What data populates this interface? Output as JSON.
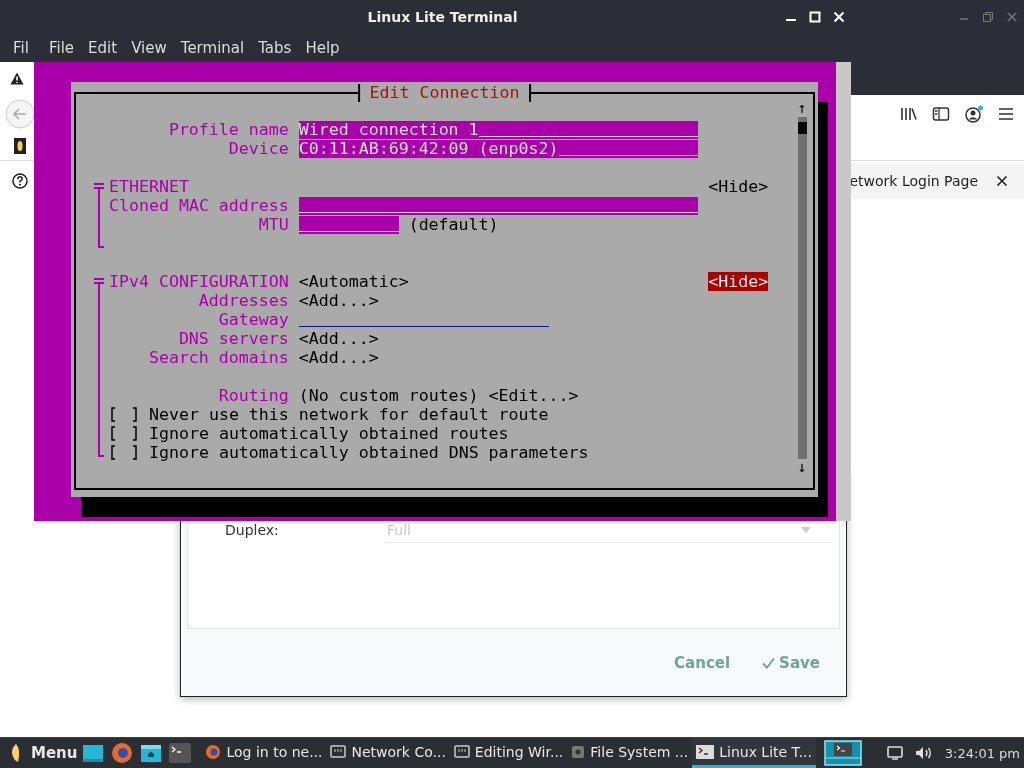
{
  "browser": {
    "menu_partial": "Fil",
    "notice_tab": "etwork Login Page"
  },
  "network_dialog": {
    "rows": [
      {
        "label": "Duplex:",
        "value": "Full",
        "disabled": true
      }
    ],
    "buttons": [
      {
        "label": "Cancel",
        "kind": "plain"
      },
      {
        "label": "Save",
        "kind": "confirm"
      }
    ]
  },
  "terminal": {
    "title": "Linux Lite Terminal",
    "menu": [
      "File",
      "Edit",
      "View",
      "Terminal",
      "Tabs",
      "Help"
    ],
    "dialog": {
      "title": "Edit Connection",
      "scroll_up": "↑",
      "scroll_down": "↓",
      "top_fields": [
        {
          "label": "Profile name",
          "value": "Wired connection 1"
        },
        {
          "label": "Device",
          "value": "C0:11:AB:69:42:09 (enp0s2)"
        }
      ],
      "sections": [
        {
          "heading": "ETHERNET",
          "toggle": "<Hide>",
          "toggle_focused": false,
          "rows": [
            {
              "kind": "field",
              "label": "Cloned MAC address"
            },
            {
              "kind": "short_field",
              "label": "MTU",
              "suffix": "(default)"
            },
            {
              "kind": "spacer"
            }
          ]
        },
        {
          "heading": "IPv4 CONFIGURATION",
          "mode": "<Automatic>",
          "toggle": "<Hide>",
          "toggle_focused": true,
          "rows": [
            {
              "kind": "button",
              "label": "Addresses",
              "value": "<Add...>"
            },
            {
              "kind": "underline_field",
              "label": "Gateway"
            },
            {
              "kind": "button",
              "label": "DNS servers",
              "value": "<Add...>"
            },
            {
              "kind": "button",
              "label": "Search domains",
              "value": "<Add...>"
            },
            {
              "kind": "spacer"
            },
            {
              "kind": "text_button",
              "label": "Routing",
              "value": "(No custom routes)",
              "button": "<Edit...>"
            },
            {
              "kind": "checkbox",
              "checked": false,
              "label": "Never use this network for default route"
            },
            {
              "kind": "checkbox",
              "checked": false,
              "label": "Ignore automatically obtained routes"
            },
            {
              "kind": "checkbox",
              "checked": false,
              "label": "Ignore automatically obtained DNS parameters"
            }
          ]
        }
      ]
    }
  },
  "taskbar": {
    "menu": "Menu",
    "tasks": [
      {
        "label": "Log in to ne...",
        "kind": "browser",
        "selected": false
      },
      {
        "label": "Network Co...",
        "kind": "network",
        "selected": false
      },
      {
        "label": "Editing Wir...",
        "kind": "network",
        "selected": false
      },
      {
        "label": "File System ...",
        "kind": "disk",
        "selected": false
      },
      {
        "label": "Linux Lite T...",
        "kind": "terminal",
        "selected": true
      }
    ],
    "clock": "3:24:01 pm"
  }
}
